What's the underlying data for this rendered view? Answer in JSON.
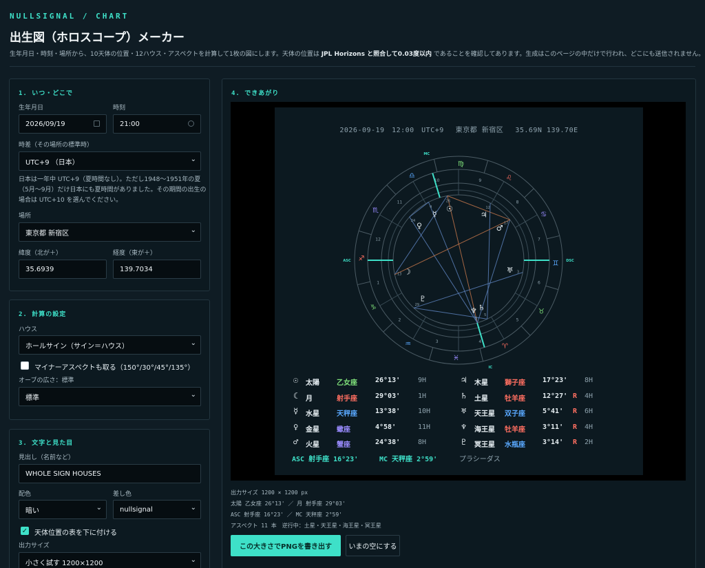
{
  "header": {
    "brand": "NULLSIGNAL / CHART",
    "title": "出生図（ホロスコープ）メーカー",
    "intro_a": "生年月日・時刻・場所から、10天体の位置・12ハウス・アスペクトを計算して1枚の図にします。天体の位置は ",
    "intro_b": "JPL Horizons と照合して0.03度以内",
    "intro_c": " であることを確認してあります。生成はこのページの中だけで行われ、どこにも送信されません。"
  },
  "panel1": {
    "title": "1. いつ・どこで",
    "date_label": "生年月日",
    "date_value": "2026/09/19",
    "time_label": "時刻",
    "time_value": "21:00",
    "tz_label": "時差（その場所の標準時）",
    "tz_value": "UTC+9 （日本）",
    "note_lines": [
      "日本は一年中 UTC+9（夏時間なし）。ただし1948〜1951年の夏",
      "（5月〜9月）だけ日本にも夏時間がありました。その期間の出生の",
      "場合は UTC+10 を選んでください。"
    ],
    "place_label": "場所",
    "place_value": "東京都 新宿区",
    "lat_label": "緯度（北が＋）",
    "lat_value": "35.6939",
    "lon_label": "経度（東が＋）",
    "lon_value": "139.7034"
  },
  "panel2": {
    "title": "2. 計算の設定",
    "house_label": "ハウス",
    "house_value": "ホールサイン（サイン＝ハウス）",
    "minor_label": "マイナーアスペクトも取る（150°/30°/45°/135°）",
    "minor_checked": false,
    "orb_label": "オーブの広さ：標準",
    "orb_value": "標準"
  },
  "panel3": {
    "title": "3. 文字と見た目",
    "heading_label": "見出し（名前など）",
    "heading_value": "WHOLE SIGN HOUSES",
    "scheme_label": "配色",
    "scheme_value": "暗い",
    "accent_label": "差し色",
    "accent_value": "nullsignal",
    "table_label": "天体位置の表を下に付ける",
    "table_checked": true,
    "size_label": "出力サイズ",
    "size_value": "小さく試す 1200×1200"
  },
  "result": {
    "title": "4. できあがり",
    "chart_header": "2026-09-19　12:00　UTC+9　 東京都 新宿区　 35.69N 139.70E",
    "wheel": {
      "asc_label": "ASC",
      "dsc_label": "DSC",
      "mc_label": "MC",
      "ic_label": "IC",
      "signs": [
        {
          "glyph": "♐",
          "color": "#ff6f61",
          "lon": 255
        },
        {
          "glyph": "♑",
          "color": "#7fe07a",
          "lon": 285
        },
        {
          "glyph": "♒",
          "color": "#5aa9ff",
          "lon": 315
        },
        {
          "glyph": "♓",
          "color": "#9a8cff",
          "lon": 345
        },
        {
          "glyph": "♈",
          "color": "#ff6f61",
          "lon": 15
        },
        {
          "glyph": "♉",
          "color": "#7fe07a",
          "lon": 45
        },
        {
          "glyph": "♊",
          "color": "#5aa9ff",
          "lon": 75
        },
        {
          "glyph": "♋",
          "color": "#9a8cff",
          "lon": 105
        },
        {
          "glyph": "♌",
          "color": "#ff6f61",
          "lon": 135
        },
        {
          "glyph": "♍",
          "color": "#7fe07a",
          "lon": 165
        },
        {
          "glyph": "♎",
          "color": "#5aa9ff",
          "lon": 195
        },
        {
          "glyph": "♏",
          "color": "#9a8cff",
          "lon": 225
        }
      ],
      "house_numbers": [
        "1",
        "2",
        "3",
        "4",
        "5",
        "6",
        "7",
        "8",
        "9",
        "10",
        "11",
        "12"
      ],
      "planets": [
        {
          "glyph": "☉",
          "lon": 176.22
        },
        {
          "glyph": "☽",
          "lon": 269.05
        },
        {
          "glyph": "☿",
          "lon": 193.63
        },
        {
          "glyph": "♀",
          "lon": 214.97
        },
        {
          "glyph": "♂",
          "lon": 114.63
        },
        {
          "glyph": "♃",
          "lon": 137.38
        },
        {
          "glyph": "♄",
          "lon": 12.45
        },
        {
          "glyph": "♅",
          "lon": 65.68
        },
        {
          "glyph": "♆",
          "lon": 3.18
        },
        {
          "glyph": "♇",
          "lon": 303.23
        }
      ],
      "degree_labels": [
        "26",
        "13",
        "4",
        "24",
        "17",
        "12",
        "5",
        "3",
        "3",
        "29"
      ]
    },
    "positions_left": [
      {
        "glyph": "☉",
        "name": "太陽",
        "sign": "乙女座",
        "sign_color": "#7fe07a",
        "deg": "26°13'",
        "r": "",
        "house": "9H"
      },
      {
        "glyph": "☾",
        "name": "月",
        "sign": "射手座",
        "sign_color": "#ff6f61",
        "deg": "29°03'",
        "r": "",
        "house": "1H"
      },
      {
        "glyph": "☿",
        "name": "水星",
        "sign": "天秤座",
        "sign_color": "#5aa9ff",
        "deg": "13°38'",
        "r": "",
        "house": "10H"
      },
      {
        "glyph": "♀",
        "name": "金星",
        "sign": "蠍座",
        "sign_color": "#9a8cff",
        "deg": "4°58'",
        "r": "",
        "house": "11H"
      },
      {
        "glyph": "♂",
        "name": "火星",
        "sign": "蟹座",
        "sign_color": "#9a8cff",
        "deg": "24°38'",
        "r": "",
        "house": "8H"
      }
    ],
    "positions_right": [
      {
        "glyph": "♃",
        "name": "木星",
        "sign": "獅子座",
        "sign_color": "#ff6f61",
        "deg": "17°23'",
        "r": "",
        "house": "8H"
      },
      {
        "glyph": "♄",
        "name": "土星",
        "sign": "牡羊座",
        "sign_color": "#ff6f61",
        "deg": "12°27'",
        "r": "R",
        "house": "4H"
      },
      {
        "glyph": "♅",
        "name": "天王星",
        "sign": "双子座",
        "sign_color": "#5aa9ff",
        "deg": "5°41'",
        "r": "R",
        "house": "6H"
      },
      {
        "glyph": "♆",
        "name": "海王星",
        "sign": "牡羊座",
        "sign_color": "#ff6f61",
        "deg": "3°11'",
        "r": "R",
        "house": "4H"
      },
      {
        "glyph": "♇",
        "name": "冥王星",
        "sign": "水瓶座",
        "sign_color": "#5aa9ff",
        "deg": "3°14'",
        "r": "R",
        "house": "2H"
      }
    ],
    "asc_line": "ASC 射手座 16°23'",
    "mc_line": "MC 天秤座 2°59'",
    "system_line": "プラシーダス",
    "summary": [
      "出力サイズ 1200 × 1200 px",
      "太陽 乙女座 26°13' ／ 月 射手座 29°03'",
      "ASC 射手座 16°23' ／ MC 天秤座 2°59'",
      "アスペクト 11 本　逆行中：土星・天王星・海王星・冥王星"
    ],
    "export_button": "この大きさでPNGを書き出す",
    "clear_button": "いまの空にする"
  },
  "colors": {
    "accent": "#3ee0c8",
    "retro": "#ff6f61"
  }
}
